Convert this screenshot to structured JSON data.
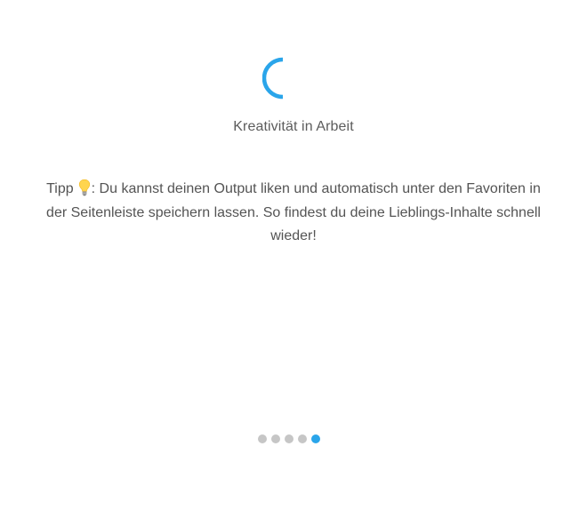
{
  "loading": {
    "status": "Kreativität in Arbeit",
    "spinner_color": "#2aa5ea",
    "icon": "loading-spinner-icon"
  },
  "tip": {
    "prefix": "Tipp",
    "icon": "lightbulb-icon",
    "text": ": Du kannst deinen Output liken und automatisch unter den Favoriten in der Seitenleiste speichern lassen. So findest du deine Lieblings-Inhalte schnell wieder!"
  },
  "pagination": {
    "total": 5,
    "active_index": 4,
    "active_color": "#2aa5ea",
    "inactive_color": "#c6c6c6"
  }
}
